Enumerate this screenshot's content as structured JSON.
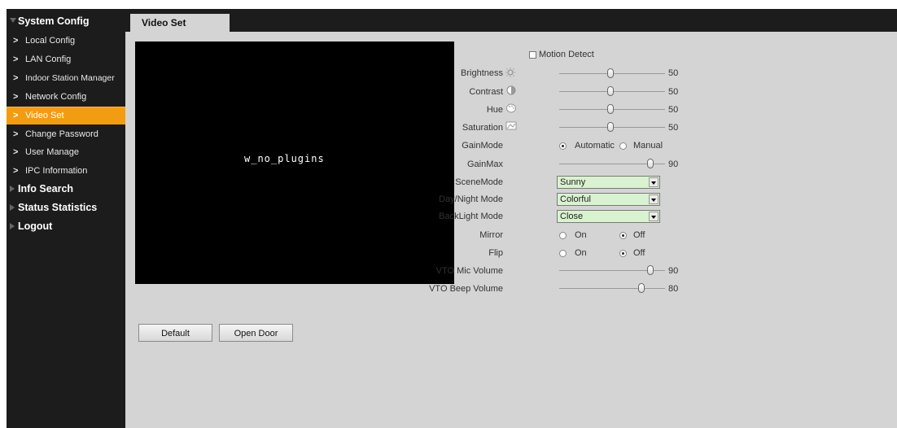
{
  "sidebar": {
    "sections": [
      {
        "label": "System Config",
        "expanded": true
      },
      {
        "label": "Info Search",
        "expanded": false
      },
      {
        "label": "Status Statistics",
        "expanded": false
      },
      {
        "label": "Logout",
        "expanded": false
      }
    ],
    "items": [
      {
        "label": "Local Config"
      },
      {
        "label": "LAN Config"
      },
      {
        "label": "Indoor Station Manager"
      },
      {
        "label": "Network Config"
      },
      {
        "label": "Video Set",
        "active": true
      },
      {
        "label": "Change Password"
      },
      {
        "label": "User Manage"
      },
      {
        "label": "IPC Information"
      }
    ],
    "arrow": ">"
  },
  "tab": {
    "label": "Video Set"
  },
  "video": {
    "placeholder": "w_no_plugins"
  },
  "buttons": {
    "default": "Default",
    "open_door": "Open Door"
  },
  "form": {
    "motion_detect": {
      "label": "Motion Detect",
      "checked": false
    },
    "brightness": {
      "label": "Brightness",
      "value": "50",
      "icon": "sun-icon"
    },
    "contrast": {
      "label": "Contrast",
      "value": "50",
      "icon": "contrast-icon"
    },
    "hue": {
      "label": "Hue",
      "value": "50",
      "icon": "palette-icon"
    },
    "saturation": {
      "label": "Saturation",
      "value": "50",
      "icon": "saturation-icon"
    },
    "gain_mode": {
      "label": "GainMode",
      "options": [
        "Automatic",
        "Manual"
      ],
      "selected": "Automatic"
    },
    "gain_max": {
      "label": "GainMax",
      "value": "90"
    },
    "scene_mode": {
      "label": "SceneMode",
      "value": "Sunny"
    },
    "day_night": {
      "label": "Day/Night Mode",
      "value": "Colorful"
    },
    "backlight": {
      "label": "BackLight Mode",
      "value": "Close"
    },
    "mirror": {
      "label": "Mirror",
      "on_label": "On",
      "off_label": "Off",
      "selected": "Off"
    },
    "flip": {
      "label": "Flip",
      "on_label": "On",
      "off_label": "Off",
      "selected": "Off"
    },
    "vto_mic": {
      "label": "VTO Mic Volume",
      "value": "90"
    },
    "vto_beep": {
      "label": "VTO Beep Volume",
      "value": "80"
    }
  },
  "colors": {
    "active_item": "#f29d11",
    "sidebar_bg": "#1c1c1c",
    "content_bg": "#d4d4d4",
    "select_bg": "#d9f2cf"
  }
}
